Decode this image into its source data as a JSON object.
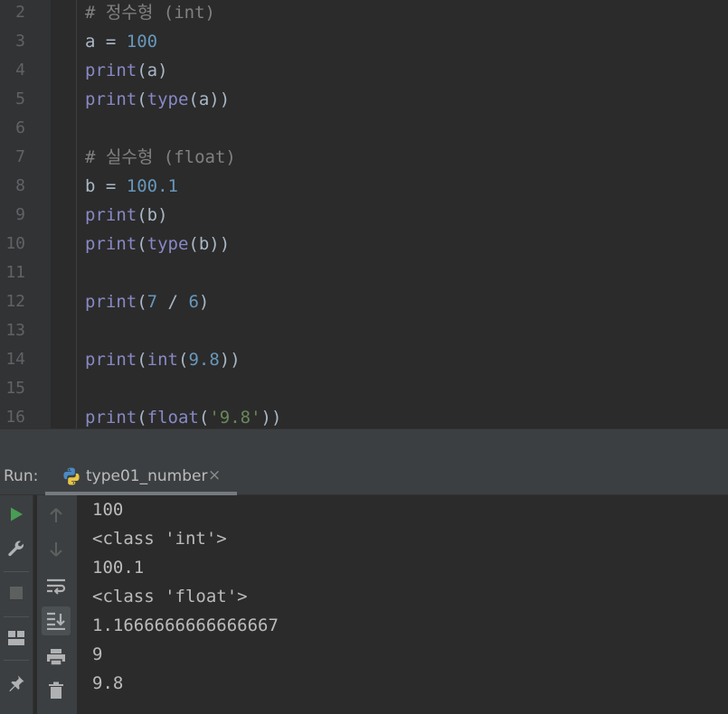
{
  "editor": {
    "lines": [
      {
        "num": "2",
        "tokens": [
          {
            "t": "# 정수형 (int)",
            "k": "comment"
          }
        ]
      },
      {
        "num": "3",
        "tokens": [
          {
            "t": "a = ",
            "k": "plain"
          },
          {
            "t": "100",
            "k": "number"
          }
        ]
      },
      {
        "num": "4",
        "tokens": [
          {
            "t": "print",
            "k": "builtin"
          },
          {
            "t": "(a)",
            "k": "plain"
          }
        ]
      },
      {
        "num": "5",
        "tokens": [
          {
            "t": "print",
            "k": "builtin"
          },
          {
            "t": "(",
            "k": "plain"
          },
          {
            "t": "type",
            "k": "builtin"
          },
          {
            "t": "(a))",
            "k": "plain"
          }
        ]
      },
      {
        "num": "6",
        "tokens": []
      },
      {
        "num": "7",
        "tokens": [
          {
            "t": "# 실수형 (float)",
            "k": "comment"
          }
        ]
      },
      {
        "num": "8",
        "tokens": [
          {
            "t": "b = ",
            "k": "plain"
          },
          {
            "t": "100.1",
            "k": "number"
          }
        ]
      },
      {
        "num": "9",
        "tokens": [
          {
            "t": "print",
            "k": "builtin"
          },
          {
            "t": "(b)",
            "k": "plain"
          }
        ]
      },
      {
        "num": "10",
        "tokens": [
          {
            "t": "print",
            "k": "builtin"
          },
          {
            "t": "(",
            "k": "plain"
          },
          {
            "t": "type",
            "k": "builtin"
          },
          {
            "t": "(b))",
            "k": "plain"
          }
        ]
      },
      {
        "num": "11",
        "tokens": []
      },
      {
        "num": "12",
        "tokens": [
          {
            "t": "print",
            "k": "builtin"
          },
          {
            "t": "(",
            "k": "plain"
          },
          {
            "t": "7",
            "k": "number"
          },
          {
            "t": " / ",
            "k": "plain"
          },
          {
            "t": "6",
            "k": "number"
          },
          {
            "t": ")",
            "k": "plain"
          }
        ]
      },
      {
        "num": "13",
        "tokens": []
      },
      {
        "num": "14",
        "tokens": [
          {
            "t": "print",
            "k": "builtin"
          },
          {
            "t": "(",
            "k": "plain"
          },
          {
            "t": "int",
            "k": "builtin"
          },
          {
            "t": "(",
            "k": "plain"
          },
          {
            "t": "9.8",
            "k": "number"
          },
          {
            "t": "))",
            "k": "plain"
          }
        ]
      },
      {
        "num": "15",
        "tokens": []
      },
      {
        "num": "16",
        "tokens": [
          {
            "t": "print",
            "k": "builtin"
          },
          {
            "t": "(",
            "k": "plain"
          },
          {
            "t": "float",
            "k": "builtin"
          },
          {
            "t": "(",
            "k": "plain"
          },
          {
            "t": "'9.8'",
            "k": "string"
          },
          {
            "t": "))",
            "k": "plain"
          }
        ]
      }
    ]
  },
  "run": {
    "label": "Run:",
    "tab_label": "type01_number",
    "tab_close": "×",
    "output": [
      "100",
      "<class 'int'>",
      "100.1",
      "<class 'float'>",
      "1.1666666666666667",
      "9",
      "9.8"
    ]
  },
  "toolbar": {
    "left": [
      "play-icon",
      "wrench-icon",
      "stop-icon",
      "layout-icon",
      "pin-icon"
    ],
    "right": [
      "arrow-up-icon",
      "arrow-down-icon",
      "soft-wrap-icon",
      "scroll-to-end-icon",
      "print-icon",
      "trash-icon"
    ]
  },
  "colors": {
    "comment": "#808080",
    "builtin": "#8888c6",
    "number": "#6897bb",
    "string": "#6a8759",
    "plain": "#a9b7c6",
    "run_green": "#499c54"
  }
}
